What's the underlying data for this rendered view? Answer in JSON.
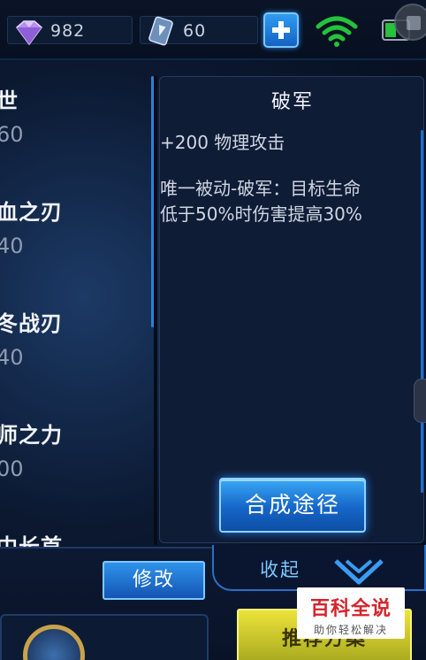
{
  "topbar": {
    "diamond_count": "982",
    "voucher_count": "60",
    "icons": [
      "diamond-icon",
      "voucher-card-icon",
      "plus-icon",
      "wifi-icon",
      "battery-icon"
    ]
  },
  "item_list": [
    {
      "name": "世",
      "price": "60"
    },
    {
      "name": "血之刃",
      "price": "40"
    },
    {
      "name": "冬战刃",
      "price": "40"
    },
    {
      "name": "师之力",
      "price": "00"
    },
    {
      "name": "中长首",
      "price": ""
    }
  ],
  "detail": {
    "title": "破军",
    "stat": "+200 物理攻击",
    "desc_line1": "唯一被动-破军：目标生命",
    "desc_line2": "低于50%时伤害提高30%",
    "compose_button": "合成途径"
  },
  "bottom": {
    "edit_button": "修改",
    "collapse_label": "收起",
    "recommend_button": "推荐方案"
  },
  "watermark": {
    "main": "百科全说",
    "sub": "助你轻松解决"
  },
  "colors": {
    "accent_blue": "#1f7ee8",
    "wifi_green": "#25c23a",
    "recommend_yellow": "#d8d22e",
    "watermark_red": "#d5232c"
  }
}
